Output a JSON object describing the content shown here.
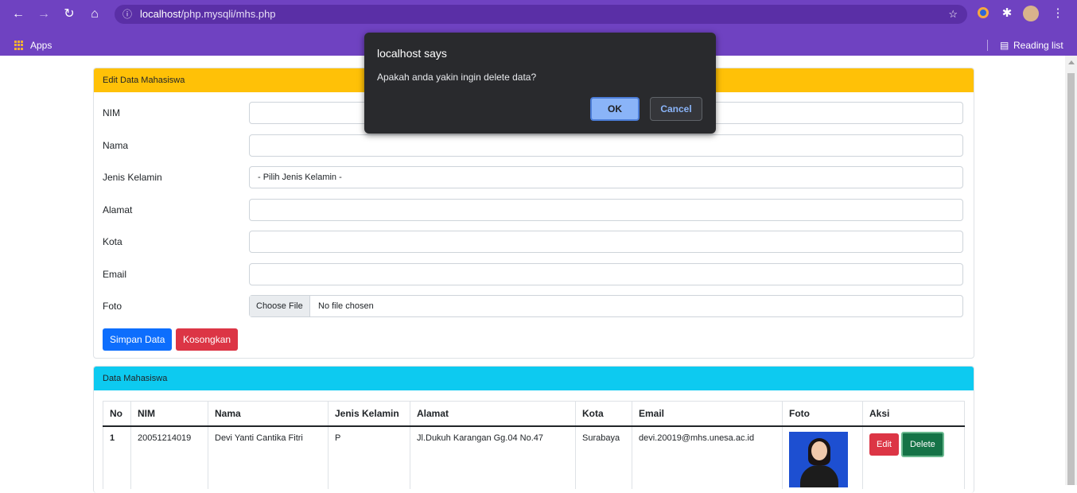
{
  "browser": {
    "url_host": "localhost",
    "url_path": "/php.mysqli/mhs.php",
    "bookmarks": {
      "apps_label": "Apps",
      "reading_list_label": "Reading list"
    }
  },
  "edit_card": {
    "title": "Edit Data Mahasiswa",
    "fields": {
      "nim_label": "NIM",
      "nama_label": "Nama",
      "jenis_kelamin_label": "Jenis Kelamin",
      "jenis_kelamin_value": "- Pilih Jenis Kelamin -",
      "alamat_label": "Alamat",
      "kota_label": "Kota",
      "email_label": "Email",
      "foto_label": "Foto",
      "file_button_label": "Choose File",
      "file_status": "No file chosen"
    },
    "buttons": {
      "save": "Simpan Data",
      "clear": "Kosongkan"
    }
  },
  "data_card": {
    "title": "Data Mahasiswa",
    "columns": [
      "No",
      "NIM",
      "Nama",
      "Jenis Kelamin",
      "Alamat",
      "Kota",
      "Email",
      "Foto",
      "Aksi"
    ],
    "rows": [
      {
        "no": "1",
        "nim": "20051214019",
        "nama": "Devi Yanti Cantika Fitri",
        "jenis_kelamin": "P",
        "alamat": "Jl.Dukuh Karangan Gg.04 No.47",
        "kota": "Surabaya",
        "email": "devi.20019@mhs.unesa.ac.id",
        "edit_label": "Edit",
        "delete_label": "Delete"
      }
    ]
  },
  "dialog": {
    "title": "localhost says",
    "message": "Apakah anda yakin ingin delete data?",
    "ok_label": "OK",
    "cancel_label": "Cancel"
  },
  "colors": {
    "browser_frame": "#6f42c1",
    "edit_header": "#ffc107",
    "data_header": "#0dcaf0",
    "primary": "#0d6efd",
    "danger": "#dc3545",
    "success": "#157347"
  }
}
